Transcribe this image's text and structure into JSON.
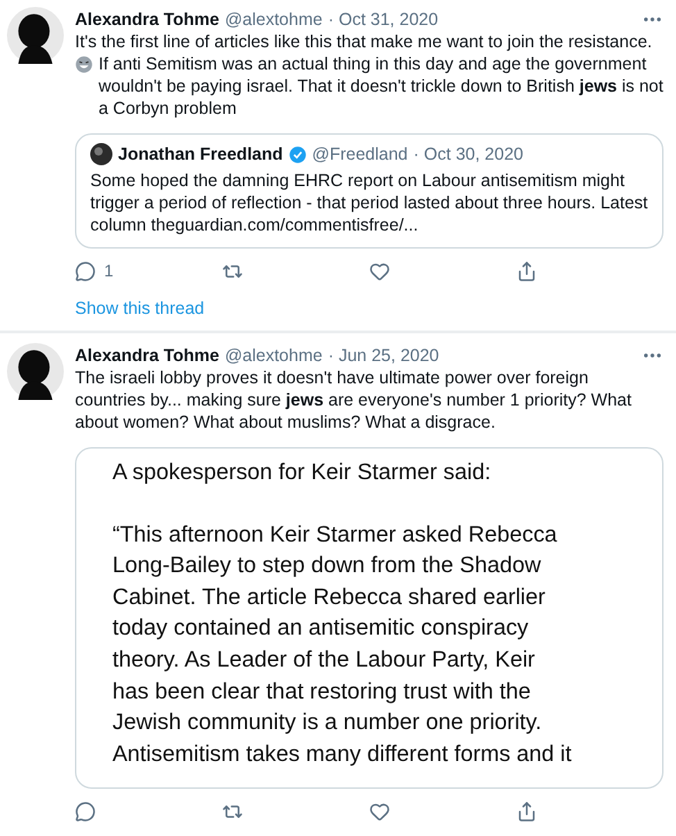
{
  "tweets": [
    {
      "name": "Alexandra Tohme",
      "handle": "@alextohme",
      "date": "· Oct 31, 2020",
      "text_parts": [
        {
          "kind": "text",
          "text": "It's the first line of articles like this that make me want to join the resistance."
        },
        {
          "kind": "emoji_text",
          "text": "If anti Semitism was an actual thing in this day and age the government wouldn't be paying israel. That it doesn't trickle down to British **jews** is not a Corbyn problem"
        }
      ],
      "quote": {
        "kind": "tweet",
        "name": "Jonathan Freedland",
        "verified": true,
        "handle": "@Freedland",
        "date": "· Oct 30, 2020",
        "text": "Some hoped the damning EHRC report on Labour antisemitism might trigger a period of reflection - that period lasted about three hours. Latest column theguardian.com/commentisfree/..."
      },
      "reply_count": "1",
      "show_thread": "Show this thread"
    },
    {
      "name": "Alexandra Tohme",
      "handle": "@alextohme",
      "date": "· Jun 25, 2020",
      "text_parts": [
        {
          "kind": "text",
          "text": "The israeli lobby proves it doesn't have ultimate power over foreign countries by... making sure **jews** are everyone's number 1 priority? What about women? What about muslims? What a disgrace."
        }
      ],
      "quote": {
        "kind": "statement",
        "heading": "A spokesperson for Keir Starmer said:",
        "lines": [
          "“This afternoon Keir Starmer asked Rebecca",
          "Long-Bailey to step down from the Shadow",
          "Cabinet. The article Rebecca shared earlier",
          "today contained an antisemitic conspiracy",
          "theory. As Leader of the Labour Party, Keir",
          "has been clear that restoring trust with the",
          "Jewish community is a number one priority.",
          "Antisemitism takes many different forms and it"
        ]
      }
    }
  ]
}
